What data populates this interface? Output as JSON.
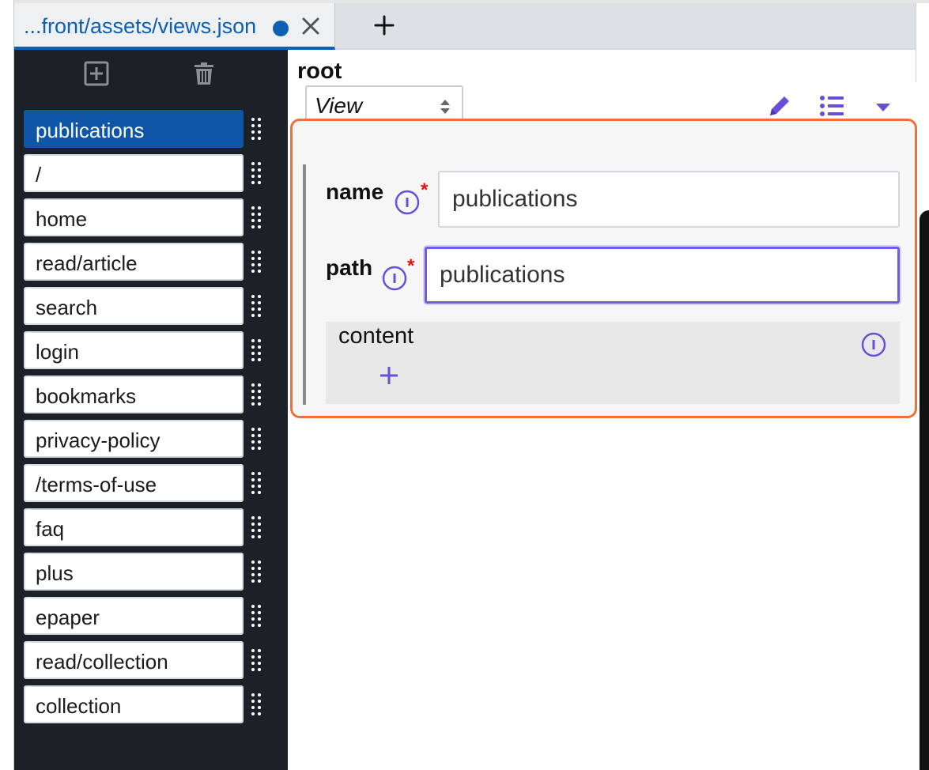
{
  "tab": {
    "title": "...front/assets/views.json"
  },
  "sidebar": {
    "items": [
      {
        "label": "publications",
        "active": true
      },
      {
        "label": "/"
      },
      {
        "label": "home"
      },
      {
        "label": "read/article"
      },
      {
        "label": "search"
      },
      {
        "label": "login"
      },
      {
        "label": "bookmarks"
      },
      {
        "label": "privacy-policy"
      },
      {
        "label": "/terms-of-use"
      },
      {
        "label": "faq"
      },
      {
        "label": "plus"
      },
      {
        "label": "epaper"
      },
      {
        "label": "read/collection"
      },
      {
        "label": "collection"
      }
    ]
  },
  "main": {
    "root_label": "root",
    "type_select": {
      "value": "View"
    },
    "form": {
      "name": {
        "label": "name",
        "required": "*",
        "value": "publications"
      },
      "path": {
        "label": "path",
        "required": "*",
        "value": "publications"
      },
      "content": {
        "label": "content"
      }
    }
  },
  "colors": {
    "accent": "#0f5fb4",
    "panel_border": "#e8733a",
    "focus": "#6d5ce0",
    "icon": "#6a4fd6",
    "required": "#e01515",
    "sidebar_bg": "#1c2027"
  },
  "icons": {
    "tab_modified": "dot-icon",
    "tab_close": "close-icon",
    "new_tab": "plus-icon",
    "add_item": "add-box-icon",
    "delete_item": "trash-icon",
    "drag": "drag-handle-icon",
    "edit": "pencil-icon",
    "list": "list-icon",
    "menu": "caret-down-icon",
    "info": "info-icon",
    "add_content": "plus-icon"
  }
}
